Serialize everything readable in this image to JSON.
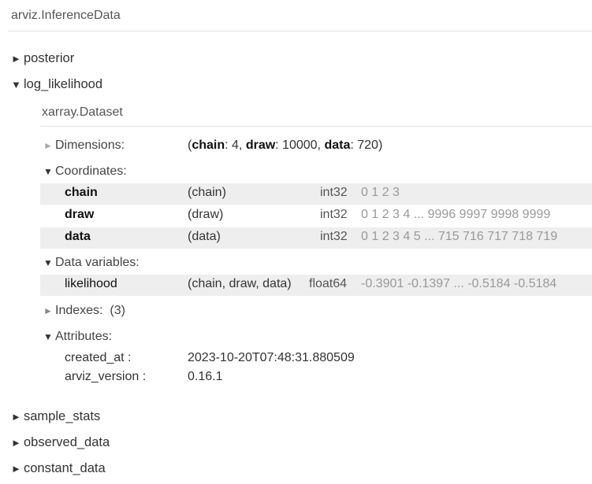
{
  "header": {
    "title": "arviz.InferenceData"
  },
  "groups": {
    "posterior": "posterior",
    "log_likelihood": "log_likelihood",
    "sample_stats": "sample_stats",
    "observed_data": "observed_data",
    "constant_data": "constant_data"
  },
  "icons": {
    "collapsed": "triangle-right-icon",
    "expanded": "triangle-down-icon"
  },
  "dataset": {
    "title": "xarray.Dataset",
    "dimensions": {
      "label": "Dimensions:",
      "open": "(",
      "close": ")",
      "items": [
        {
          "name": "chain",
          "sep": ": ",
          "value": "4",
          "comma": ", "
        },
        {
          "name": "draw",
          "sep": ": ",
          "value": "10000",
          "comma": ", "
        },
        {
          "name": "data",
          "sep": ": ",
          "value": "720",
          "comma": ""
        }
      ]
    },
    "coordinates": {
      "label": "Coordinates:",
      "rows": [
        {
          "name": "chain",
          "dims": "(chain)",
          "dtype": "int32",
          "preview": "0 1 2 3"
        },
        {
          "name": "draw",
          "dims": "(draw)",
          "dtype": "int32",
          "preview": "0 1 2 3 4 ... 9996 9997 9998 9999"
        },
        {
          "name": "data",
          "dims": "(data)",
          "dtype": "int32",
          "preview": "0 1 2 3 4 5 ... 715 716 717 718 719"
        }
      ]
    },
    "data_variables": {
      "label": "Data variables:",
      "rows": [
        {
          "name": "likelihood",
          "dims": "(chain, draw, data)",
          "dtype": "float64",
          "preview": "-0.3901 -0.1397 ... -0.5184 -0.5184"
        }
      ]
    },
    "indexes": {
      "label": "Indexes:",
      "count": "(3)"
    },
    "attributes": {
      "label": "Attributes:",
      "items": [
        {
          "key": "created_at :",
          "value": "2023-10-20T07:48:31.880509"
        },
        {
          "key": "arviz_version :",
          "value": "0.16.1"
        }
      ]
    }
  }
}
